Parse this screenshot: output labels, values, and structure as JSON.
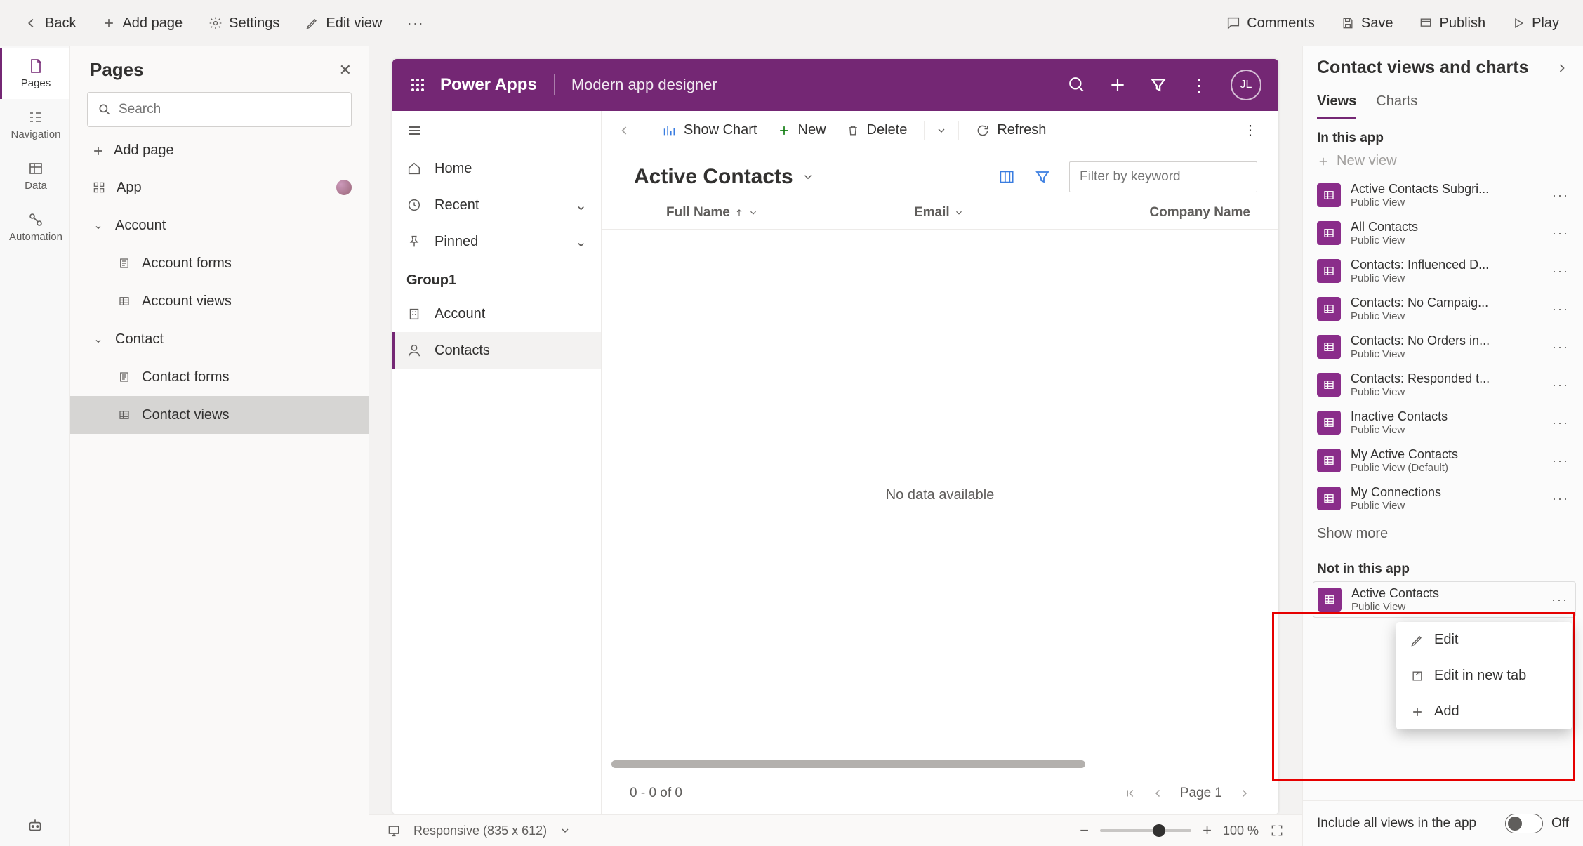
{
  "toolbar": {
    "back": "Back",
    "addPage": "Add page",
    "settings": "Settings",
    "editView": "Edit view",
    "comments": "Comments",
    "save": "Save",
    "publish": "Publish",
    "play": "Play"
  },
  "rail": {
    "pages": "Pages",
    "navigation": "Navigation",
    "data": "Data",
    "automation": "Automation"
  },
  "pagesPanel": {
    "title": "Pages",
    "searchPlaceholder": "Search",
    "addPage": "Add page",
    "app": "App",
    "account": "Account",
    "accountForms": "Account forms",
    "accountViews": "Account views",
    "contact": "Contact",
    "contactForms": "Contact forms",
    "contactViews": "Contact views"
  },
  "powerapps": {
    "brand": "Power Apps",
    "appName": "Modern app designer",
    "avatar": "JL"
  },
  "canvasNav": {
    "home": "Home",
    "recent": "Recent",
    "pinned": "Pinned",
    "group": "Group1",
    "account": "Account",
    "contacts": "Contacts"
  },
  "commandBar": {
    "showChart": "Show Chart",
    "new": "New",
    "delete": "Delete",
    "refresh": "Refresh"
  },
  "view": {
    "title": "Active Contacts",
    "filterPlaceholder": "Filter by keyword",
    "colFullName": "Full Name",
    "colEmail": "Email",
    "colCompany": "Company Name",
    "noData": "No data available",
    "range": "0 - 0 of 0",
    "page": "Page 1"
  },
  "status": {
    "responsive": "Responsive (835 x 612)",
    "zoom": "100 %"
  },
  "rightPanel": {
    "title": "Contact views and charts",
    "tabViews": "Views",
    "tabCharts": "Charts",
    "inThisApp": "In this app",
    "newView": "New view",
    "showMore": "Show more",
    "notInThisApp": "Not in this app",
    "includeAll": "Include all views in the app",
    "off": "Off",
    "views": [
      {
        "name": "Active Contacts Subgri...",
        "sub": "Public View"
      },
      {
        "name": "All Contacts",
        "sub": "Public View"
      },
      {
        "name": "Contacts: Influenced D...",
        "sub": "Public View"
      },
      {
        "name": "Contacts: No Campaig...",
        "sub": "Public View"
      },
      {
        "name": "Contacts: No Orders in...",
        "sub": "Public View"
      },
      {
        "name": "Contacts: Responded t...",
        "sub": "Public View"
      },
      {
        "name": "Inactive Contacts",
        "sub": "Public View"
      },
      {
        "name": "My Active Contacts",
        "sub": "Public View (Default)"
      },
      {
        "name": "My Connections",
        "sub": "Public View"
      }
    ],
    "notInViews": [
      {
        "name": "Active Contacts",
        "sub": "Public View"
      }
    ]
  },
  "contextMenu": {
    "edit": "Edit",
    "editNewTab": "Edit in new tab",
    "add": "Add"
  }
}
